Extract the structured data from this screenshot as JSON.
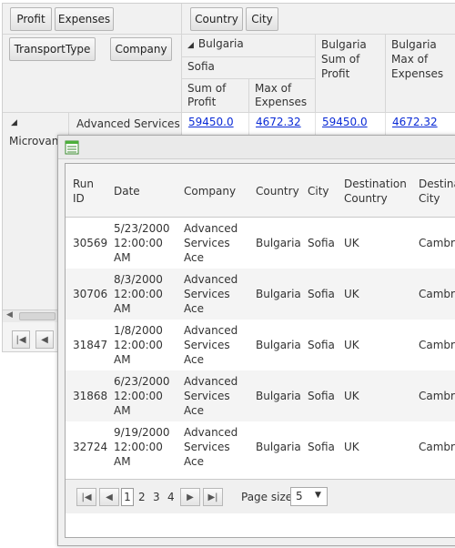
{
  "pivot": {
    "data_fields": [
      "Profit",
      "Expenses"
    ],
    "column_fields": [
      "Country",
      "City"
    ],
    "row_fields": [
      "TransportType",
      "Company"
    ],
    "country_header": "Bulgaria",
    "city_header": "Sofia",
    "measure_headers": [
      "Sum of Profit",
      "Max of Expenses"
    ],
    "total_headers": [
      "Bulgaria Sum of Profit",
      "Bulgaria Max of Expenses"
    ],
    "row_header_1": "Microvan",
    "row_header_2": "Advanced Services",
    "values": [
      "59450.0",
      "4672.32",
      "59450.0",
      "4672.32"
    ]
  },
  "popup": {
    "columns": [
      "Run ID",
      "Date",
      "Company",
      "Country",
      "City",
      "Destination Country",
      "Destination City"
    ],
    "rows": [
      {
        "run_id": "30569",
        "date": "5/23/2000 12:00:00 AM",
        "company": "Advanced Services Ace",
        "country": "Bulgaria",
        "city": "Sofia",
        "dest_country": "UK",
        "dest_city": "Cambridge"
      },
      {
        "run_id": "30706",
        "date": "8/3/2000 12:00:00 AM",
        "company": "Advanced Services Ace",
        "country": "Bulgaria",
        "city": "Sofia",
        "dest_country": "UK",
        "dest_city": "Cambridge"
      },
      {
        "run_id": "31847",
        "date": "1/8/2000 12:00:00 AM",
        "company": "Advanced Services Ace",
        "country": "Bulgaria",
        "city": "Sofia",
        "dest_country": "UK",
        "dest_city": "Cambridge"
      },
      {
        "run_id": "31868",
        "date": "6/23/2000 12:00:00 AM",
        "company": "Advanced Services Ace",
        "country": "Bulgaria",
        "city": "Sofia",
        "dest_country": "UK",
        "dest_city": "Cambridge"
      },
      {
        "run_id": "32724",
        "date": "9/19/2000 12:00:00 AM",
        "company": "Advanced Services Ace",
        "country": "Bulgaria",
        "city": "Sofia",
        "dest_country": "UK",
        "dest_city": "Cambridge"
      }
    ],
    "pager": {
      "pages": [
        "1",
        "2",
        "3",
        "4"
      ],
      "current_page": "1",
      "page_size_label": "Page size:",
      "page_size_value": "5"
    }
  }
}
